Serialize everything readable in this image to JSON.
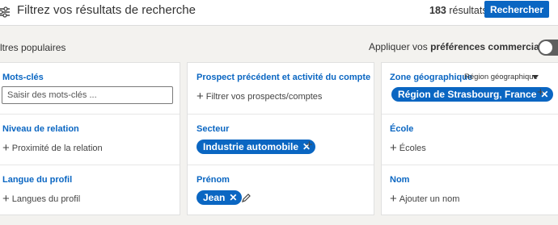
{
  "header": {
    "title": "Filtrez vos résultats de recherche",
    "results_count": "183",
    "results_label": "résultats",
    "search_button": "Rechercher"
  },
  "top_bar": {
    "filters_label": "ltres populaires",
    "prefs_prefix": "Appliquer vos",
    "prefs_bold": "préférences commerciales"
  },
  "columns": [
    {
      "cells": [
        {
          "title": "Mots-clés",
          "input_placeholder": "Saisir des mots-clés ..."
        },
        {
          "title": "Niveau de relation",
          "add_label": "Proximité de la relation"
        },
        {
          "title": "Langue du profil",
          "add_label": "Langues du profil"
        }
      ]
    },
    {
      "cells": [
        {
          "title": "Prospect précédent et activité du compte",
          "add_label": "Filtrer vos prospects/comptes"
        },
        {
          "title": "Secteur",
          "chip": "Industrie automobile"
        },
        {
          "title": "Prénom",
          "chip": "Jean"
        }
      ]
    },
    {
      "cells": [
        {
          "title": "Zone géographique",
          "dropdown": "Région géographique",
          "chip": "Région de Strasbourg, France"
        },
        {
          "title": "École",
          "add_label": "Écoles"
        },
        {
          "title": "Nom",
          "add_label": "Ajouter un nom"
        }
      ]
    }
  ],
  "colors": {
    "accent": "#0a66c2",
    "toggle_off": "#5e5e5e",
    "background": "#f3f2ef"
  },
  "icons": [
    "filter-sliders-icon",
    "plus-icon",
    "close-icon",
    "caret-down-icon",
    "pencil-icon"
  ]
}
